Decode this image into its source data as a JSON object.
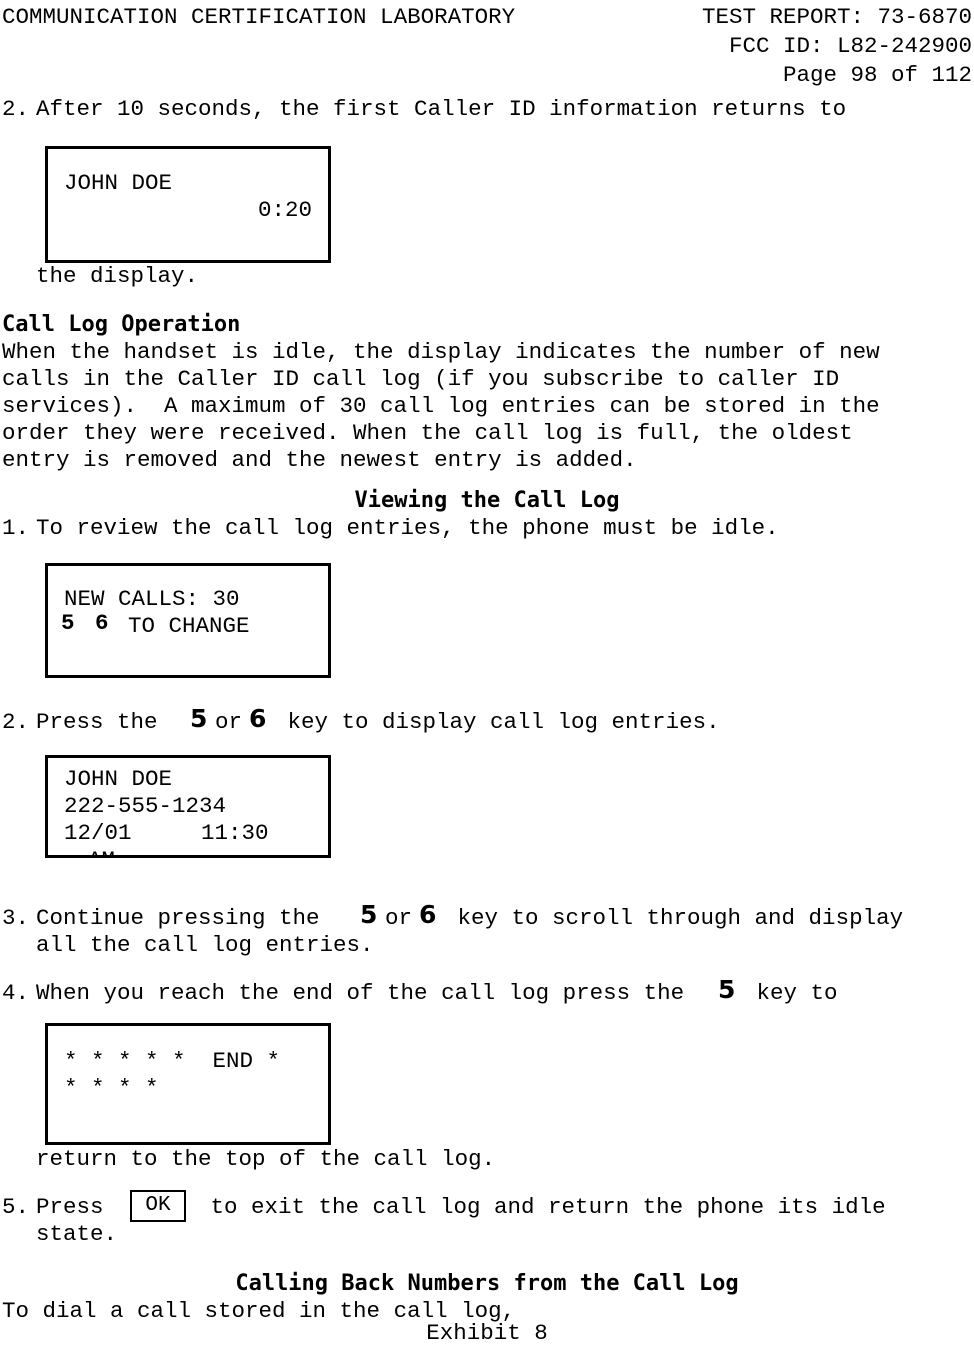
{
  "header": {
    "lab_name": "COMMUNICATION CERTIFICATION LABORATORY",
    "test_report": "TEST REPORT: 73-6870",
    "fcc_id": "FCC ID: L82-242900",
    "page_number": "Page 98 of 112"
  },
  "steps": {
    "step2_top": "2.",
    "step2_top_text": "After 10 seconds, the first Caller ID information returns to",
    "step2_top_cont": "the display.",
    "step1_num": "1.",
    "step1_text": "To review the call log entries, the phone must be idle.",
    "step2_num": "2.",
    "step2_a": "Press the ",
    "step2_key1": "5",
    "step2_b": "or ",
    "step2_key2": "6",
    "step2_c": " key to display call log entries.",
    "step3_num": "3.",
    "step3_a": "Continue pressing the ",
    "step3_key1": "5",
    "step3_b": "or ",
    "step3_key2": "6",
    "step3_c": " key to scroll through and display",
    "step3_line2": "all the call log entries.",
    "step4_num": "4.",
    "step4_a": "When you reach the end of the call log press the ",
    "step4_key1": "5",
    "step4_b": " key to",
    "step4_cont": "return to the top of the call log.",
    "step5_num": "5.",
    "step5_a": "Press ",
    "step5_ok": "OK",
    "step5_b": " to exit the call log and return the phone its idle",
    "step5_line2": "state."
  },
  "sections": {
    "call_log_operation_heading": "Call Log Operation",
    "call_log_operation_body": [
      "When the handset is idle, the display indicates the number of new",
      "calls in the Caller ID call log (if you subscribe to caller ID",
      "services).  A maximum of 30 call log entries can be stored in the",
      "order they were received. When the call log is full, the oldest",
      "entry is removed and the newest entry is added."
    ],
    "viewing_heading": "Viewing the Call Log",
    "calling_back_heading": "Calling Back Numbers from the Call Log",
    "calling_back_body": "To dial a call stored in the call log,"
  },
  "lcd_displays": {
    "display1": {
      "line1": "JOHN DOE",
      "line2": "0:20"
    },
    "display2": {
      "line1": "NEW CALLS: 30",
      "key1": "5",
      "key2": "6",
      "line2_text": "TO CHANGE"
    },
    "display3": {
      "line1": "JOHN DOE",
      "line2": "222-555-1234",
      "line3_date": "12/01",
      "line3_time": "11:30",
      "line4": "AM"
    },
    "display4": {
      "line1": "* * * * *  END *",
      "line2": "* * * *"
    }
  },
  "footer": {
    "exhibit": "Exhibit 8"
  },
  "colors": {
    "text": "#000000",
    "background": "#ffffff",
    "border": "#000000"
  }
}
